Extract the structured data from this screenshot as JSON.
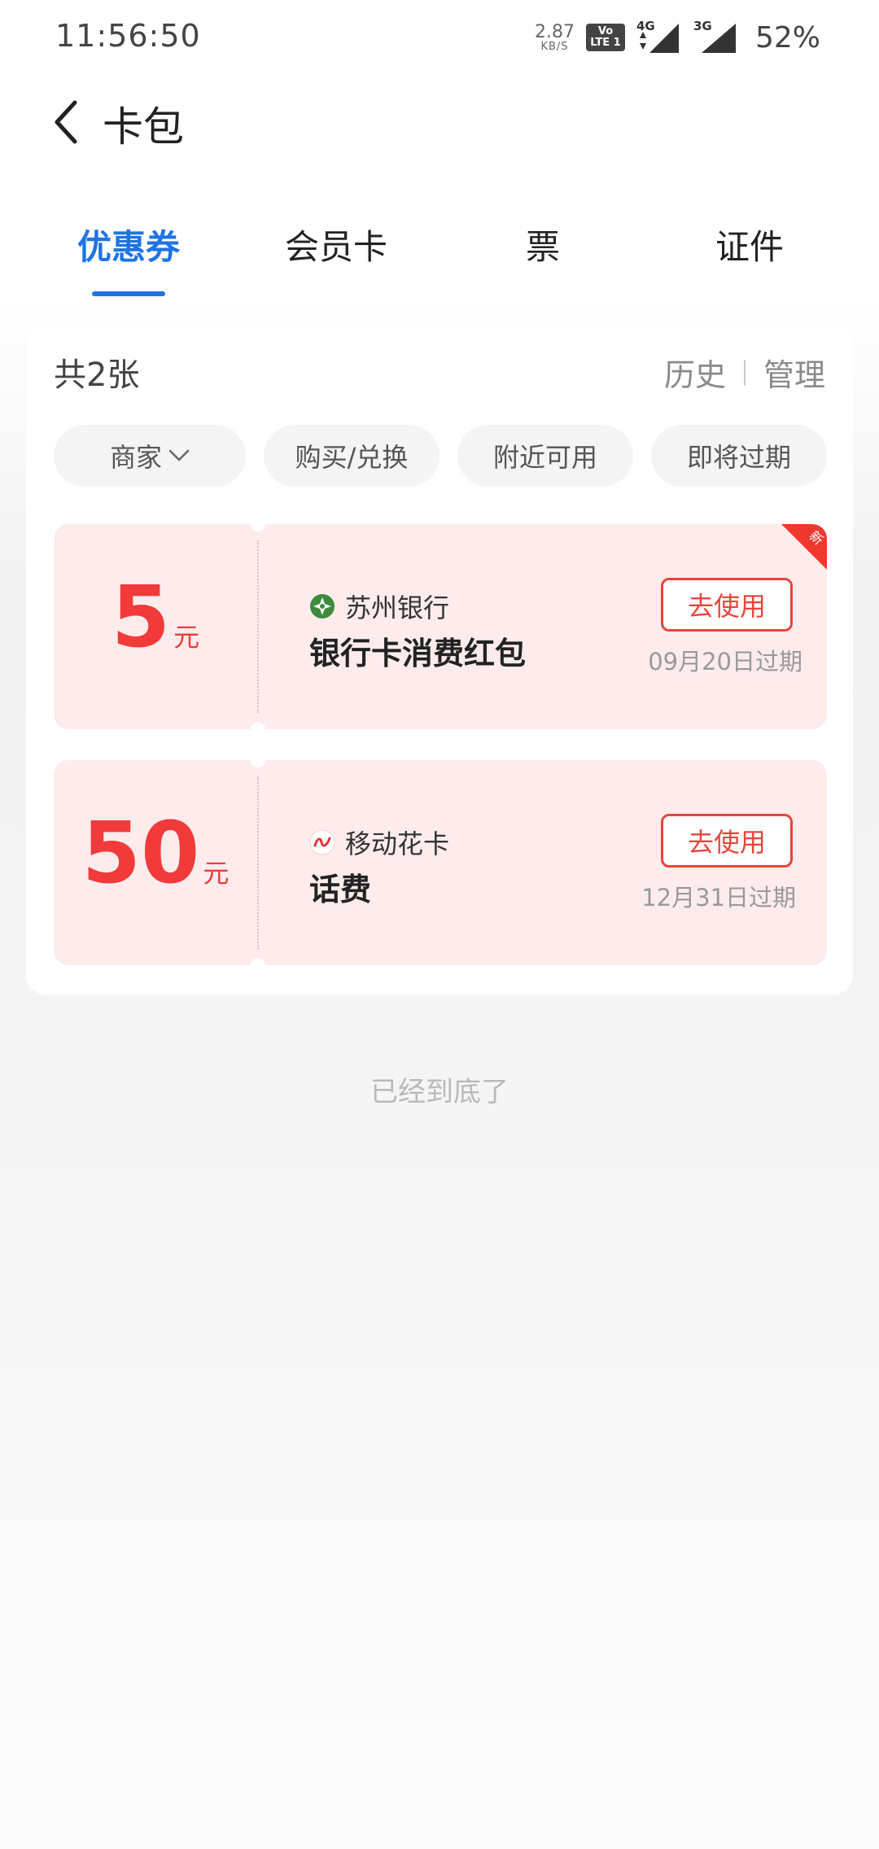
{
  "status_bar": {
    "time": "11:56:50",
    "net_speed": "2.87",
    "net_unit": "KB/S",
    "volte_top": "Vo",
    "volte_bottom": "LTE 1",
    "sim1_tag": "4G",
    "sim2_tag": "3G",
    "battery": "52%"
  },
  "header": {
    "title": "卡包"
  },
  "tabs": [
    {
      "label": "优惠券",
      "active": true
    },
    {
      "label": "会员卡",
      "active": false
    },
    {
      "label": "票",
      "active": false
    },
    {
      "label": "证件",
      "active": false
    }
  ],
  "summary": {
    "count": "共2张",
    "history": "历史",
    "manage": "管理"
  },
  "filters": [
    "商家",
    "购买/兑换",
    "附近可用",
    "即将过期"
  ],
  "coupons": [
    {
      "amount": "5",
      "unit": "元",
      "merchant": "苏州银行",
      "title": "银行卡消费红包",
      "button": "去使用",
      "expire": "09月20日过期",
      "badge": "新"
    },
    {
      "amount": "50",
      "unit": "元",
      "merchant": "移动花卡",
      "title": "话费",
      "button": "去使用",
      "expire": "12月31日过期"
    }
  ],
  "footer": {
    "note": "已经到底了"
  },
  "colors": {
    "accent": "#1f73e4",
    "coupon_red": "#f23a3a",
    "coupon_bg": "#feeced"
  }
}
